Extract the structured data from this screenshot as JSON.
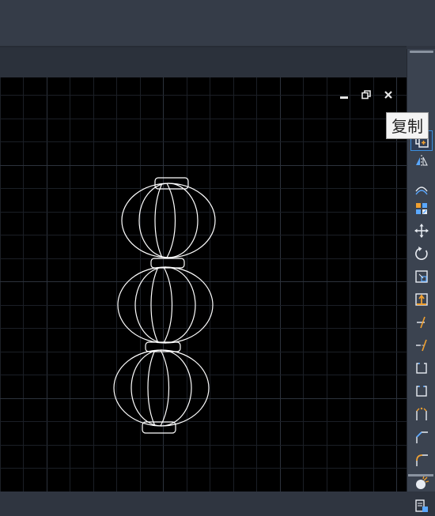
{
  "window_controls": {
    "minimize_icon": "minimize-icon",
    "restore_icon": "restore-icon",
    "close_icon": "close-icon"
  },
  "modify_toolbar": {
    "tools": [
      {
        "id": "erase",
        "icon": "eraser-icon"
      },
      {
        "id": "copy",
        "icon": "copy-icon",
        "selected": true
      },
      {
        "id": "mirror",
        "icon": "mirror-icon"
      },
      {
        "id": "offset",
        "icon": "offset-icon"
      },
      {
        "id": "array",
        "icon": "array-icon"
      },
      {
        "id": "move",
        "icon": "move-icon"
      },
      {
        "id": "rotate",
        "icon": "rotate-icon"
      },
      {
        "id": "scale",
        "icon": "scale-icon"
      },
      {
        "id": "stretch",
        "icon": "stretch-icon"
      },
      {
        "id": "trim",
        "icon": "trim-icon"
      },
      {
        "id": "extend",
        "icon": "extend-icon"
      },
      {
        "id": "break-at-point",
        "icon": "break-at-point-icon"
      },
      {
        "id": "break",
        "icon": "break-icon"
      },
      {
        "id": "join",
        "icon": "join-icon"
      },
      {
        "id": "chamfer",
        "icon": "chamfer-icon"
      },
      {
        "id": "fillet",
        "icon": "fillet-icon"
      },
      {
        "id": "explode",
        "icon": "explode-icon"
      },
      {
        "id": "properties",
        "icon": "properties-icon"
      }
    ]
  },
  "tooltip": {
    "text": "复制"
  },
  "colors": {
    "drawing_background": "#000000",
    "grid_minor": "#1b1f26",
    "grid_major": "#2c323c",
    "lantern_stroke": "#ffffff",
    "accent": "#3c8fe0",
    "icon_blue": "#5aa8ff",
    "icon_orange": "#f0a030"
  }
}
